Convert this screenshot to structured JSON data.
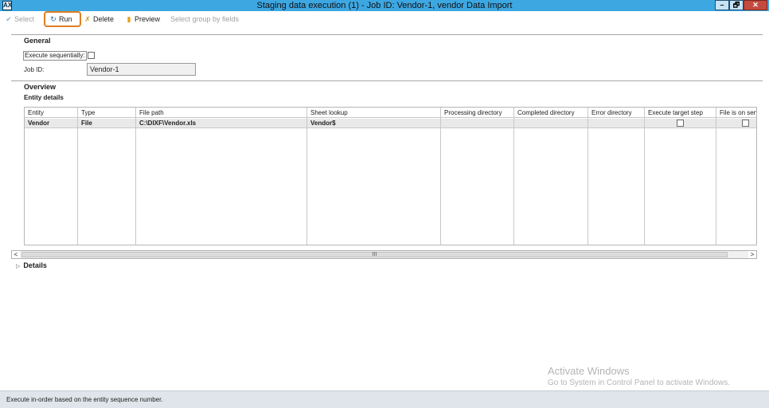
{
  "window": {
    "title": "Staging data execution (1) - Job ID: Vendor-1, vendor Data Import",
    "app_icon": "dynamics-ax-icon",
    "minimize": "–",
    "maximize": "🗗",
    "close": "✕"
  },
  "toolbar": {
    "select_label": "Select",
    "run_label": "Run",
    "delete_label": "Delete",
    "preview_label": "Preview",
    "group_label": "Select group by fields",
    "accent_color": "#e07d22"
  },
  "general": {
    "heading": "General",
    "execute_sequentially_label": "Execute sequentially:",
    "execute_sequentially_checked": false,
    "job_id_label": "Job ID:",
    "job_id_value": "Vendor-1"
  },
  "overview": {
    "heading": "Overview",
    "entity_details_heading": "Entity details",
    "columns": [
      "Entity",
      "Type",
      "File path",
      "Sheet lookup",
      "Processing directory",
      "Completed directory",
      "Error directory",
      "Execute target step",
      "File is on serv"
    ],
    "rows": [
      {
        "entity": "Vendor",
        "type": "File",
        "file_path": "C:\\DIXF\\Vendor.xls",
        "sheet_lookup": "Vendor$",
        "processing_directory": "",
        "completed_directory": "",
        "error_directory": "",
        "execute_target_step": false,
        "file_is_on_server": false
      }
    ],
    "scroll_left": "<",
    "scroll_thumb": "III",
    "scroll_right": ">"
  },
  "details": {
    "label": "Details",
    "expand_glyph": "▷"
  },
  "watermark": {
    "line1": "Activate Windows",
    "line2": "Go to System in Control Panel to activate Windows."
  },
  "status": {
    "text": "Execute in-order based on the entity sequence number."
  }
}
